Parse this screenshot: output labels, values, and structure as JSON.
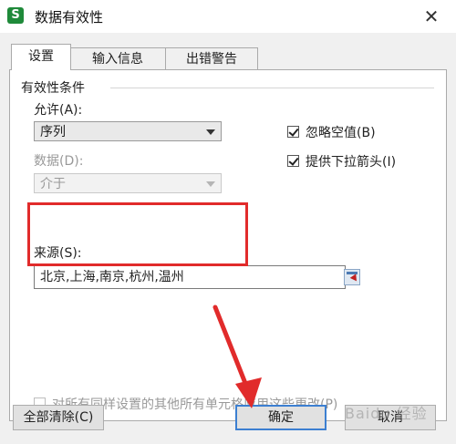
{
  "window": {
    "title": "数据有效性",
    "app_icon_letter": "S",
    "close_glyph": "✕"
  },
  "tabs": [
    {
      "label": "设置",
      "active": true
    },
    {
      "label": "输入信息",
      "active": false
    },
    {
      "label": "出错警告",
      "active": false
    }
  ],
  "settings": {
    "section_title": "有效性条件",
    "allow": {
      "label": "允许(A):",
      "value": "序列"
    },
    "data": {
      "label": "数据(D):",
      "value": "介于",
      "disabled": true
    },
    "ignore_blank": {
      "label": "忽略空值(B)",
      "checked": true
    },
    "in_cell_dropdown": {
      "label": "提供下拉箭头(I)",
      "checked": true
    },
    "source": {
      "label": "来源(S):",
      "value": "北京,上海,南京,杭州,温州"
    },
    "apply_all": {
      "label": "对所有同样设置的其他所有单元格应用这些更改(P)",
      "checked": false,
      "disabled": true
    }
  },
  "buttons": {
    "clear_all": "全部清除(C)",
    "ok": "确定",
    "cancel": "取消"
  },
  "annotations": {
    "highlight_color": "#e12b2b",
    "arrow_color": "#e12b2b"
  },
  "watermark": "Baidu 经验"
}
